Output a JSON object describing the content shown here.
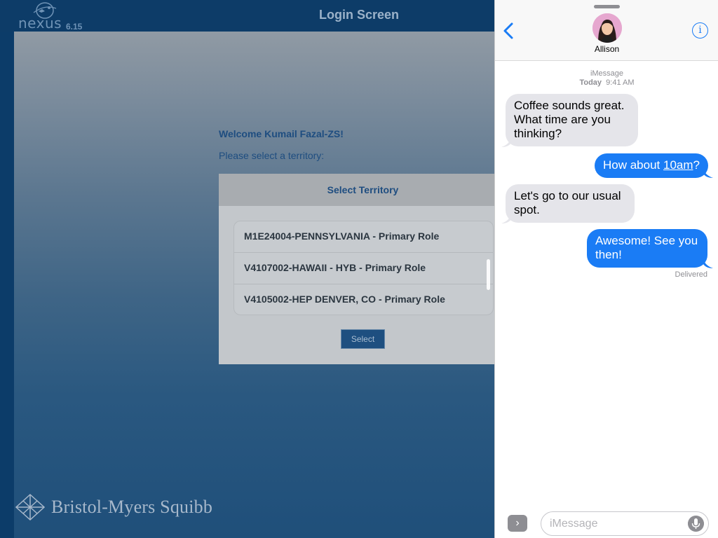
{
  "app": {
    "logo_word": "nexus",
    "version": "6.15",
    "title": "Login Screen",
    "welcome": "Welcome Kumail Fazal-ZS!",
    "prompt": "Please select a territory:",
    "panel_title": "Select Territory",
    "territories": [
      "M1E24004-PENNSYLVANIA - Primary Role",
      "V4107002-HAWAII - HYB - Primary Role",
      "V4105002-HEP DENVER, CO - Primary Role"
    ],
    "select_label": "Select",
    "brand": "Bristol-Myers Squibb",
    "colors": {
      "header": "#0d3c68",
      "accent": "#1e4d80"
    }
  },
  "messages": {
    "contact": "Allison",
    "service": "iMessage",
    "time_day": "Today",
    "time": "9:41 AM",
    "thread": [
      {
        "from": "them",
        "text": "Coffee sounds great. What time are you thinking?"
      },
      {
        "from": "me",
        "text_before": "How about ",
        "text_link": "10am",
        "text_after": "?"
      },
      {
        "from": "them",
        "text": "Let's go to our usual spot."
      },
      {
        "from": "me",
        "text": "Awesome! See you then!"
      }
    ],
    "status": "Delivered",
    "input_placeholder": "iMessage",
    "icons": [
      "back-chevron-icon",
      "info-icon",
      "app-store-icon",
      "microphone-icon"
    ],
    "colors": {
      "blue": "#1a7cf5",
      "gray_bubble": "#e5e5ea"
    }
  }
}
